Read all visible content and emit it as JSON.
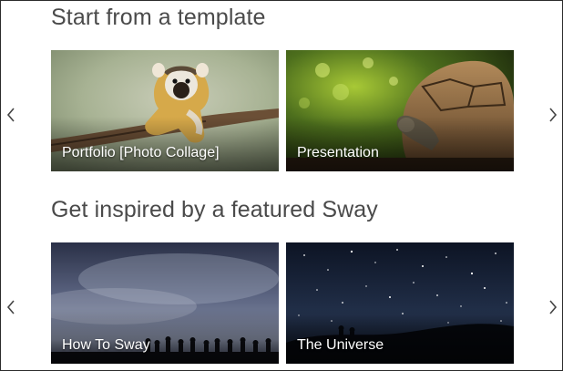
{
  "sections": [
    {
      "title": "Start from a template",
      "cards": [
        {
          "label": "Portfolio [Photo Collage]"
        },
        {
          "label": "Presentation"
        }
      ]
    },
    {
      "title": "Get inspired by a featured Sway",
      "cards": [
        {
          "label": "How To Sway"
        },
        {
          "label": "The Universe"
        }
      ]
    }
  ],
  "icons": {
    "previous": "chevron-left-icon",
    "next": "chevron-right-icon"
  },
  "colors": {
    "heading": "#4a4a4a",
    "card_label": "#ffffff",
    "arrow": "#444444",
    "border": "#2b2b2b"
  }
}
